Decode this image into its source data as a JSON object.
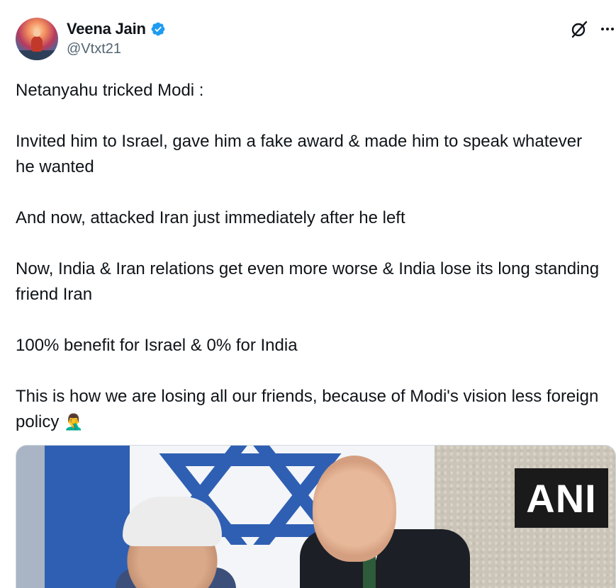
{
  "author": {
    "display_name": "Veena Jain",
    "handle": "@Vtxt21",
    "verified": true,
    "verified_color": "#1d9bf0"
  },
  "header_icons": {
    "grok": "grok-icon",
    "more": "more-options-icon"
  },
  "tweet": {
    "paragraphs": [
      "Netanyahu tricked Modi :",
      "Invited him to Israel, gave him a fake award & made him to speak whatever he wanted",
      "And now, attacked Iran just immediately after he left",
      "Now, India & Iran relations get even more worse & India lose its long standing friend Iran",
      "100% benefit for Israel & 0% for India",
      "This is how we are losing all our friends, because of Modi's vision less foreign policy"
    ],
    "emoji": "🤦‍♂️"
  },
  "media": {
    "watermark": "ANI",
    "description_icon": "photo"
  },
  "colors": {
    "text": "#0f1419",
    "secondary": "#536471",
    "border": "#cfd9de"
  }
}
